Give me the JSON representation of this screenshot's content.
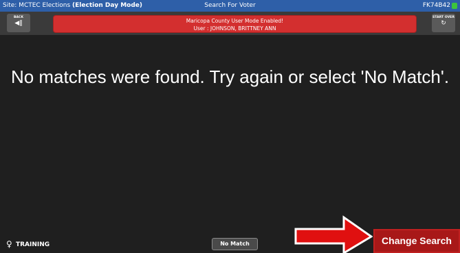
{
  "titlebar": {
    "site_prefix": "Site: MCTEC Elections",
    "mode": "(Election Day Mode)",
    "screen_title": "Search For Voter",
    "device_id": "FK74B42",
    "status_color": "#3cc43c"
  },
  "toolbar": {
    "back_label": "BACK",
    "start_over_label": "START OVER"
  },
  "banner": {
    "line1": "Maricopa County User Mode Enabled!",
    "line2": "User : JOHNSON, BRITTNEY ANN",
    "color": "#d32f2f"
  },
  "main": {
    "message": "No matches were found. Try again or select 'No Match'."
  },
  "footer": {
    "training_label": "TRAINING",
    "no_match_label": "No Match",
    "change_search_label": "Change Search",
    "arrow_color": "#e01010"
  },
  "icons": {
    "back": "back-arrow-icon",
    "start_over": "refresh-icon",
    "training": "lightbulb-icon",
    "pointer": "red-arrow-icon"
  }
}
